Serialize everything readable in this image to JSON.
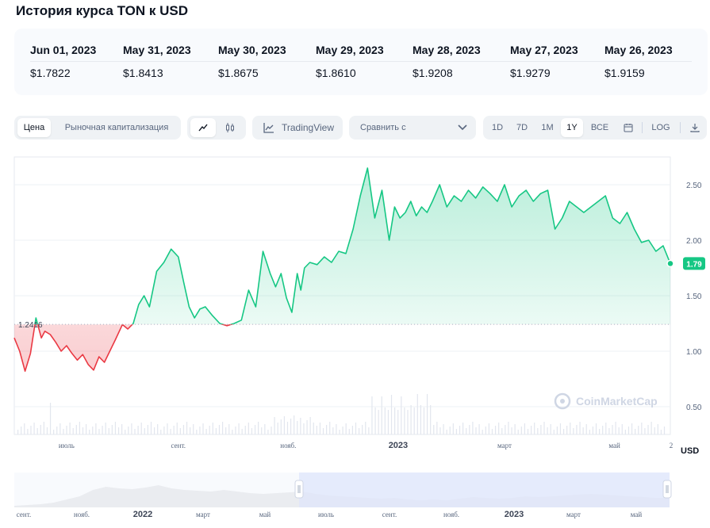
{
  "title": "История курса TON к USD",
  "history": [
    {
      "date": "Jun 01, 2023",
      "price": "$1.7822"
    },
    {
      "date": "May 31, 2023",
      "price": "$1.8413"
    },
    {
      "date": "May 30, 2023",
      "price": "$1.8675"
    },
    {
      "date": "May 29, 2023",
      "price": "$1.8610"
    },
    {
      "date": "May 28, 2023",
      "price": "$1.9208"
    },
    {
      "date": "May 27, 2023",
      "price": "$1.9279"
    },
    {
      "date": "May 26, 2023",
      "price": "$1.9159"
    }
  ],
  "toolbar": {
    "price_tab": "Цена",
    "market_cap_tab": "Рыночная капитализация",
    "tradingview": "TradingView",
    "compare": "Сравнить с",
    "ranges": [
      "1D",
      "7D",
      "1M",
      "1Y",
      "ВСЕ"
    ],
    "active_range": "1Y",
    "log": "LOG"
  },
  "colors": {
    "up": "#16c784",
    "down": "#ea3943",
    "accent": "#3861fb",
    "panel": "#f8fafd"
  },
  "chart_data": {
    "type": "line",
    "title": "",
    "ylabel": "USD",
    "ylim": [
      0.25,
      2.75
    ],
    "yticks": [
      "0.50",
      "1.00",
      "1.50",
      "2.00",
      "2.50"
    ],
    "baseline_value": 1.2416,
    "baseline_label": "1.2416",
    "current_label": "1.79",
    "watermark": "CoinMarketCap",
    "x_range": [
      "2022-06-02",
      "2023-06-01"
    ],
    "xticks": [
      {
        "label": "июль",
        "date": "2022-07-01",
        "bold": false
      },
      {
        "label": "сент.",
        "date": "2022-09-01",
        "bold": false
      },
      {
        "label": "нояб.",
        "date": "2022-11-01",
        "bold": false
      },
      {
        "label": "2023",
        "date": "2023-01-01",
        "bold": true
      },
      {
        "label": "март",
        "date": "2023-03-01",
        "bold": false
      },
      {
        "label": "май",
        "date": "2023-05-01",
        "bold": false
      },
      {
        "label": "2",
        "date": "2023-06-02",
        "bold": false
      }
    ],
    "series": [
      {
        "x": [
          "2022-06-02",
          "2022-06-05",
          "2022-06-08",
          "2022-06-11",
          "2022-06-14",
          "2022-06-17",
          "2022-06-19",
          "2022-06-22",
          "2022-06-25",
          "2022-06-28",
          "2022-07-01",
          "2022-07-04",
          "2022-07-07",
          "2022-07-10",
          "2022-07-13",
          "2022-07-16",
          "2022-07-19",
          "2022-07-22",
          "2022-07-25",
          "2022-07-28",
          "2022-08-01",
          "2022-08-04",
          "2022-08-07",
          "2022-08-10",
          "2022-08-13",
          "2022-08-16",
          "2022-08-20",
          "2022-08-24",
          "2022-08-28",
          "2022-09-01",
          "2022-09-04",
          "2022-09-07",
          "2022-09-10",
          "2022-09-13",
          "2022-09-16",
          "2022-09-20",
          "2022-09-24",
          "2022-09-28",
          "2022-10-02",
          "2022-10-06",
          "2022-10-10",
          "2022-10-14",
          "2022-10-18",
          "2022-10-22",
          "2022-10-25",
          "2022-10-28",
          "2022-10-31",
          "2022-11-03",
          "2022-11-06",
          "2022-11-08",
          "2022-11-10",
          "2022-11-13",
          "2022-11-17",
          "2022-11-21",
          "2022-11-25",
          "2022-11-29",
          "2022-12-03",
          "2022-12-07",
          "2022-12-11",
          "2022-12-15",
          "2022-12-19",
          "2022-12-23",
          "2022-12-27",
          "2022-12-30",
          "2023-01-02",
          "2023-01-05",
          "2023-01-08",
          "2023-01-11",
          "2023-01-14",
          "2023-01-17",
          "2023-01-20",
          "2023-01-24",
          "2023-01-28",
          "2023-02-01",
          "2023-02-05",
          "2023-02-09",
          "2023-02-13",
          "2023-02-17",
          "2023-02-21",
          "2023-02-25",
          "2023-03-01",
          "2023-03-05",
          "2023-03-09",
          "2023-03-13",
          "2023-03-17",
          "2023-03-21",
          "2023-03-25",
          "2023-03-29",
          "2023-04-02",
          "2023-04-06",
          "2023-04-10",
          "2023-04-14",
          "2023-04-18",
          "2023-04-22",
          "2023-04-26",
          "2023-04-30",
          "2023-05-04",
          "2023-05-08",
          "2023-05-12",
          "2023-05-16",
          "2023-05-20",
          "2023-05-24",
          "2023-05-28",
          "2023-06-01"
        ],
        "y": [
          1.12,
          1.0,
          0.82,
          0.98,
          1.3,
          1.12,
          1.18,
          1.15,
          1.08,
          1.0,
          1.05,
          0.98,
          0.92,
          0.97,
          0.88,
          0.83,
          0.95,
          0.9,
          1.0,
          1.1,
          1.24,
          1.2,
          1.25,
          1.42,
          1.5,
          1.4,
          1.72,
          1.8,
          1.92,
          1.85,
          1.62,
          1.4,
          1.3,
          1.38,
          1.4,
          1.32,
          1.25,
          1.23,
          1.25,
          1.28,
          1.55,
          1.4,
          1.9,
          1.7,
          1.58,
          1.7,
          1.48,
          1.35,
          1.7,
          1.55,
          1.75,
          1.8,
          1.78,
          1.85,
          1.8,
          1.9,
          1.88,
          2.1,
          2.4,
          2.65,
          2.2,
          2.45,
          2.0,
          2.3,
          2.2,
          2.25,
          2.35,
          2.22,
          2.3,
          2.25,
          2.35,
          2.5,
          2.3,
          2.4,
          2.35,
          2.45,
          2.38,
          2.48,
          2.42,
          2.35,
          2.5,
          2.3,
          2.4,
          2.45,
          2.35,
          2.42,
          2.45,
          2.1,
          2.2,
          2.35,
          2.3,
          2.25,
          2.3,
          2.35,
          2.4,
          2.2,
          2.15,
          2.25,
          2.1,
          1.98,
          2.0,
          1.9,
          1.95,
          1.79
        ]
      }
    ]
  }
}
